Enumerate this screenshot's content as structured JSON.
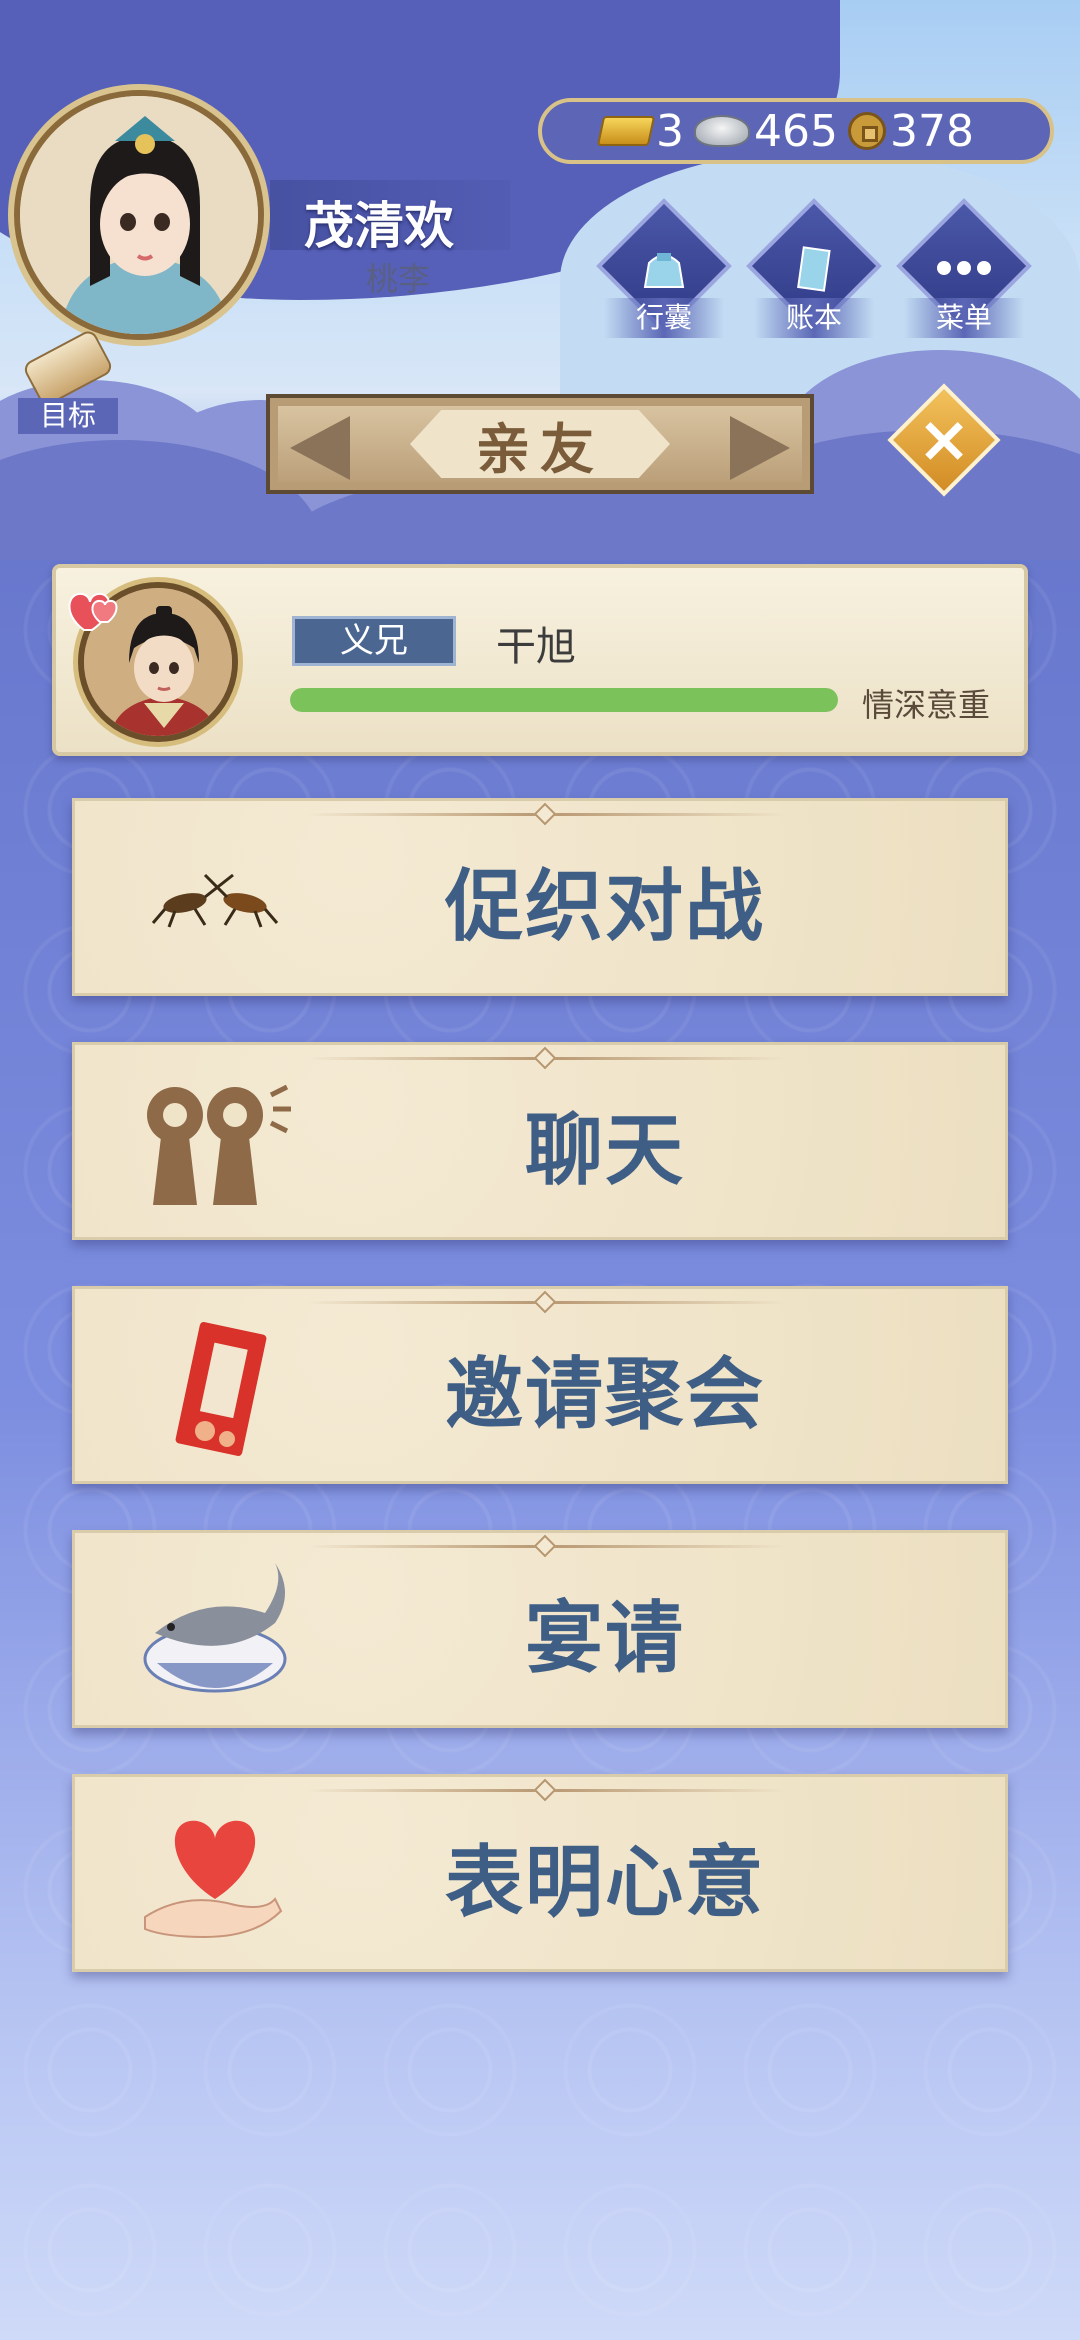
{
  "player": {
    "name": "茂清欢",
    "title": "桃李"
  },
  "currency": {
    "gold": "3",
    "silver": "465",
    "copper": "378"
  },
  "top_buttons": {
    "bag": "行囊",
    "ledger": "账本",
    "menu": "菜单"
  },
  "target_label": "目标",
  "page_title": "亲友",
  "close_label": "×",
  "friend": {
    "relation": "义兄",
    "name": "干旭",
    "bond_label": "情深意重",
    "bond_level": 1.0
  },
  "actions": [
    {
      "label": "促织对战",
      "icon": "cricket-icon"
    },
    {
      "label": "聊天",
      "icon": "chat-icon"
    },
    {
      "label": "邀请聚会",
      "icon": "invitation-card-icon"
    },
    {
      "label": "宴请",
      "icon": "feast-bowl-icon"
    },
    {
      "label": "表明心意",
      "icon": "heart-hand-icon"
    }
  ],
  "colors": {
    "accent_blue": "#3f5e85",
    "bond_green": "#7cc25a",
    "close_gold": "#e0a63a"
  }
}
